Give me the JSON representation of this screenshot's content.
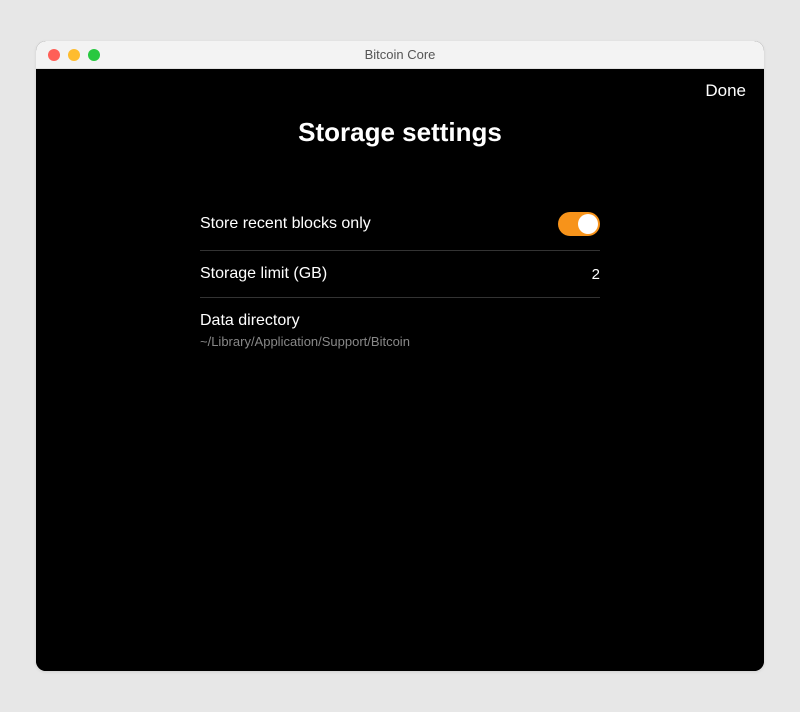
{
  "window": {
    "title": "Bitcoin Core"
  },
  "header": {
    "done_label": "Done",
    "page_title": "Storage settings"
  },
  "settings": {
    "store_recent": {
      "label": "Store recent blocks only",
      "enabled": true
    },
    "storage_limit": {
      "label": "Storage limit (GB)",
      "value": "2"
    },
    "data_directory": {
      "label": "Data directory",
      "path": "~/Library/Application/Support/Bitcoin"
    }
  },
  "colors": {
    "accent": "#f7931a"
  }
}
